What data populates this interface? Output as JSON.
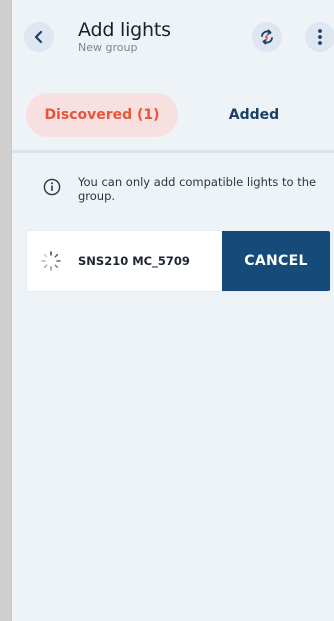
{
  "header": {
    "title": "Add lights",
    "subtitle": "New group",
    "icons": {
      "back": "chevron-left-icon",
      "sync": "sync-icon",
      "more": "more-vertical-icon"
    }
  },
  "tabs": [
    {
      "label": "Discovered (1)",
      "active": true
    },
    {
      "label": "Added",
      "active": false
    }
  ],
  "info": {
    "icon": "info-icon",
    "text": "You can only add compatible lights to the group."
  },
  "devices": [
    {
      "name": "SNS210 MC_5709",
      "status": "searching",
      "action_label": "CANCEL"
    }
  ],
  "colors": {
    "accent": "#e4573c",
    "primary": "#154a79",
    "background": "#eef3f8"
  }
}
